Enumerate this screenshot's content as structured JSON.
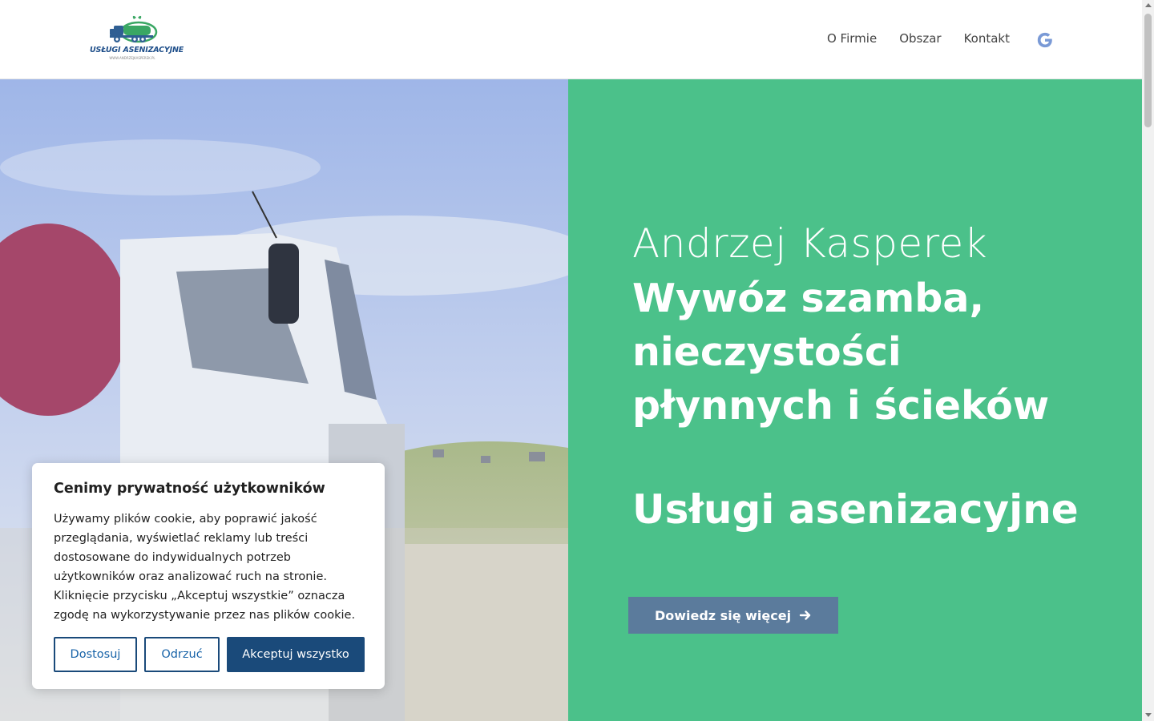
{
  "header": {
    "logo": {
      "text": "USŁUGI ASENIZACYJNE",
      "url": "WWW.ANDRZEJKASPEREK.PL",
      "icon": "septic-truck-logo-icon"
    },
    "nav": [
      {
        "label": "O Firmie"
      },
      {
        "label": "Obszar"
      },
      {
        "label": "Kontakt"
      }
    ],
    "google_icon": "google-icon"
  },
  "hero": {
    "name": "Andrzej Kasperek",
    "tagline": "Wywóz szamba, nieczystości płynnych i ścieków",
    "tagline2": "Usługi asenizacyjne",
    "button_label": "Dowiedz się więcej",
    "button_icon": "arrow-right-icon",
    "background_color": "#4bc18a",
    "button_color": "#5b7b9c"
  },
  "cookie_banner": {
    "title": "Cenimy prywatność użytkowników",
    "body": "Używamy plików cookie, aby poprawić jakość przeglądania, wyświetlać reklamy lub treści dostosowane do indywidualnych potrzeb użytkowników oraz analizować ruch na stronie. Kliknięcie przycisku „Akceptuj wszystkie” oznacza zgodę na wykorzystywanie przez nas plików cookie.",
    "buttons": {
      "customize": "Dostosuj",
      "reject": "Odrzuć",
      "accept": "Akceptuj wszystko"
    },
    "accent_color": "#1a4a7a"
  }
}
